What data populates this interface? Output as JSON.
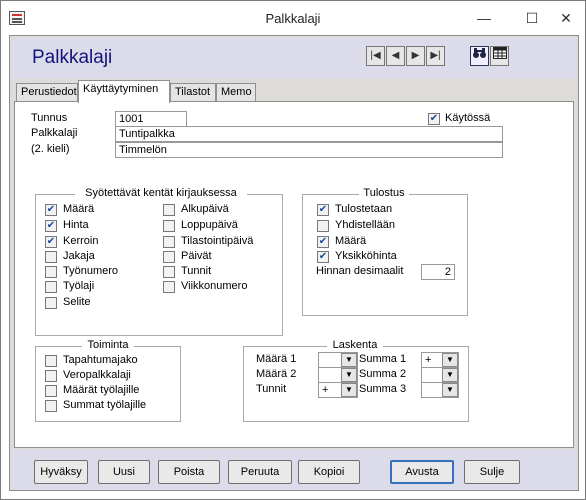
{
  "window": {
    "title": "Palkkalaji"
  },
  "form": {
    "title": "Palkkalaji"
  },
  "nav": {
    "first": "|◀",
    "prev": "◀",
    "next": "▶",
    "last": "▶|"
  },
  "tabs": [
    {
      "label": "Perustiedot",
      "active": false
    },
    {
      "label": "Käyttäytyminen",
      "active": true
    },
    {
      "label": "Tilastot",
      "active": false
    },
    {
      "label": "Memo",
      "active": false
    }
  ],
  "fields": {
    "tunnus_label": "Tunnus",
    "tunnus_value": "1001",
    "palkkalaji_label": "Palkkalaji",
    "palkkalaji_value": "Tuntipalkka",
    "kieli_label": "(2. kieli)",
    "kieli_value": "Timmelön",
    "kaytossa_label": "Käytössä",
    "kaytossa_checked": true
  },
  "syotettavat": {
    "title": "Syötettävät kentät kirjauksessa",
    "col1": [
      {
        "label": "Määrä",
        "checked": true
      },
      {
        "label": "Hinta",
        "checked": true
      },
      {
        "label": "Kerroin",
        "checked": true
      },
      {
        "label": "Jakaja",
        "checked": false
      },
      {
        "label": "Työnumero",
        "checked": false
      },
      {
        "label": "Työlaji",
        "checked": false
      },
      {
        "label": "Selite",
        "checked": false
      }
    ],
    "col2": [
      {
        "label": "Alkupäivä",
        "checked": false
      },
      {
        "label": "Loppupäivä",
        "checked": false
      },
      {
        "label": "Tilastointipäivä",
        "checked": false
      },
      {
        "label": "Päivät",
        "checked": false
      },
      {
        "label": "Tunnit",
        "checked": false
      },
      {
        "label": "Viikkonumero",
        "checked": false
      }
    ]
  },
  "tulostus": {
    "title": "Tulostus",
    "items": [
      {
        "label": "Tulostetaan",
        "checked": true
      },
      {
        "label": "Yhdistellään",
        "checked": false
      },
      {
        "label": "Määrä",
        "checked": true
      },
      {
        "label": "Yksikköhinta",
        "checked": true
      }
    ],
    "desimaalit_label": "Hinnan desimaalit",
    "desimaalit_value": "2"
  },
  "toiminta": {
    "title": "Toiminta",
    "items": [
      {
        "label": "Tapahtumajako",
        "checked": false
      },
      {
        "label": "Veropalkkalaji",
        "checked": false
      },
      {
        "label": "Määrät työlajille",
        "checked": false
      },
      {
        "label": "Summat työlajille",
        "checked": false
      }
    ]
  },
  "laskenta": {
    "title": "Laskenta",
    "left": [
      {
        "label": "Määrä 1",
        "value": ""
      },
      {
        "label": "Määrä 2",
        "value": ""
      },
      {
        "label": "Tunnit",
        "value": "+"
      }
    ],
    "right": [
      {
        "label": "Summa 1",
        "value": "+"
      },
      {
        "label": "Summa 2",
        "value": ""
      },
      {
        "label": "Summa 3",
        "value": ""
      }
    ]
  },
  "buttons": {
    "hyvaksy": "Hyväksy",
    "uusi": "Uusi",
    "poista": "Poista",
    "peruuta": "Peruuta",
    "kopioi": "Kopioi",
    "avusta": "Avusta",
    "sulje": "Sulje"
  }
}
